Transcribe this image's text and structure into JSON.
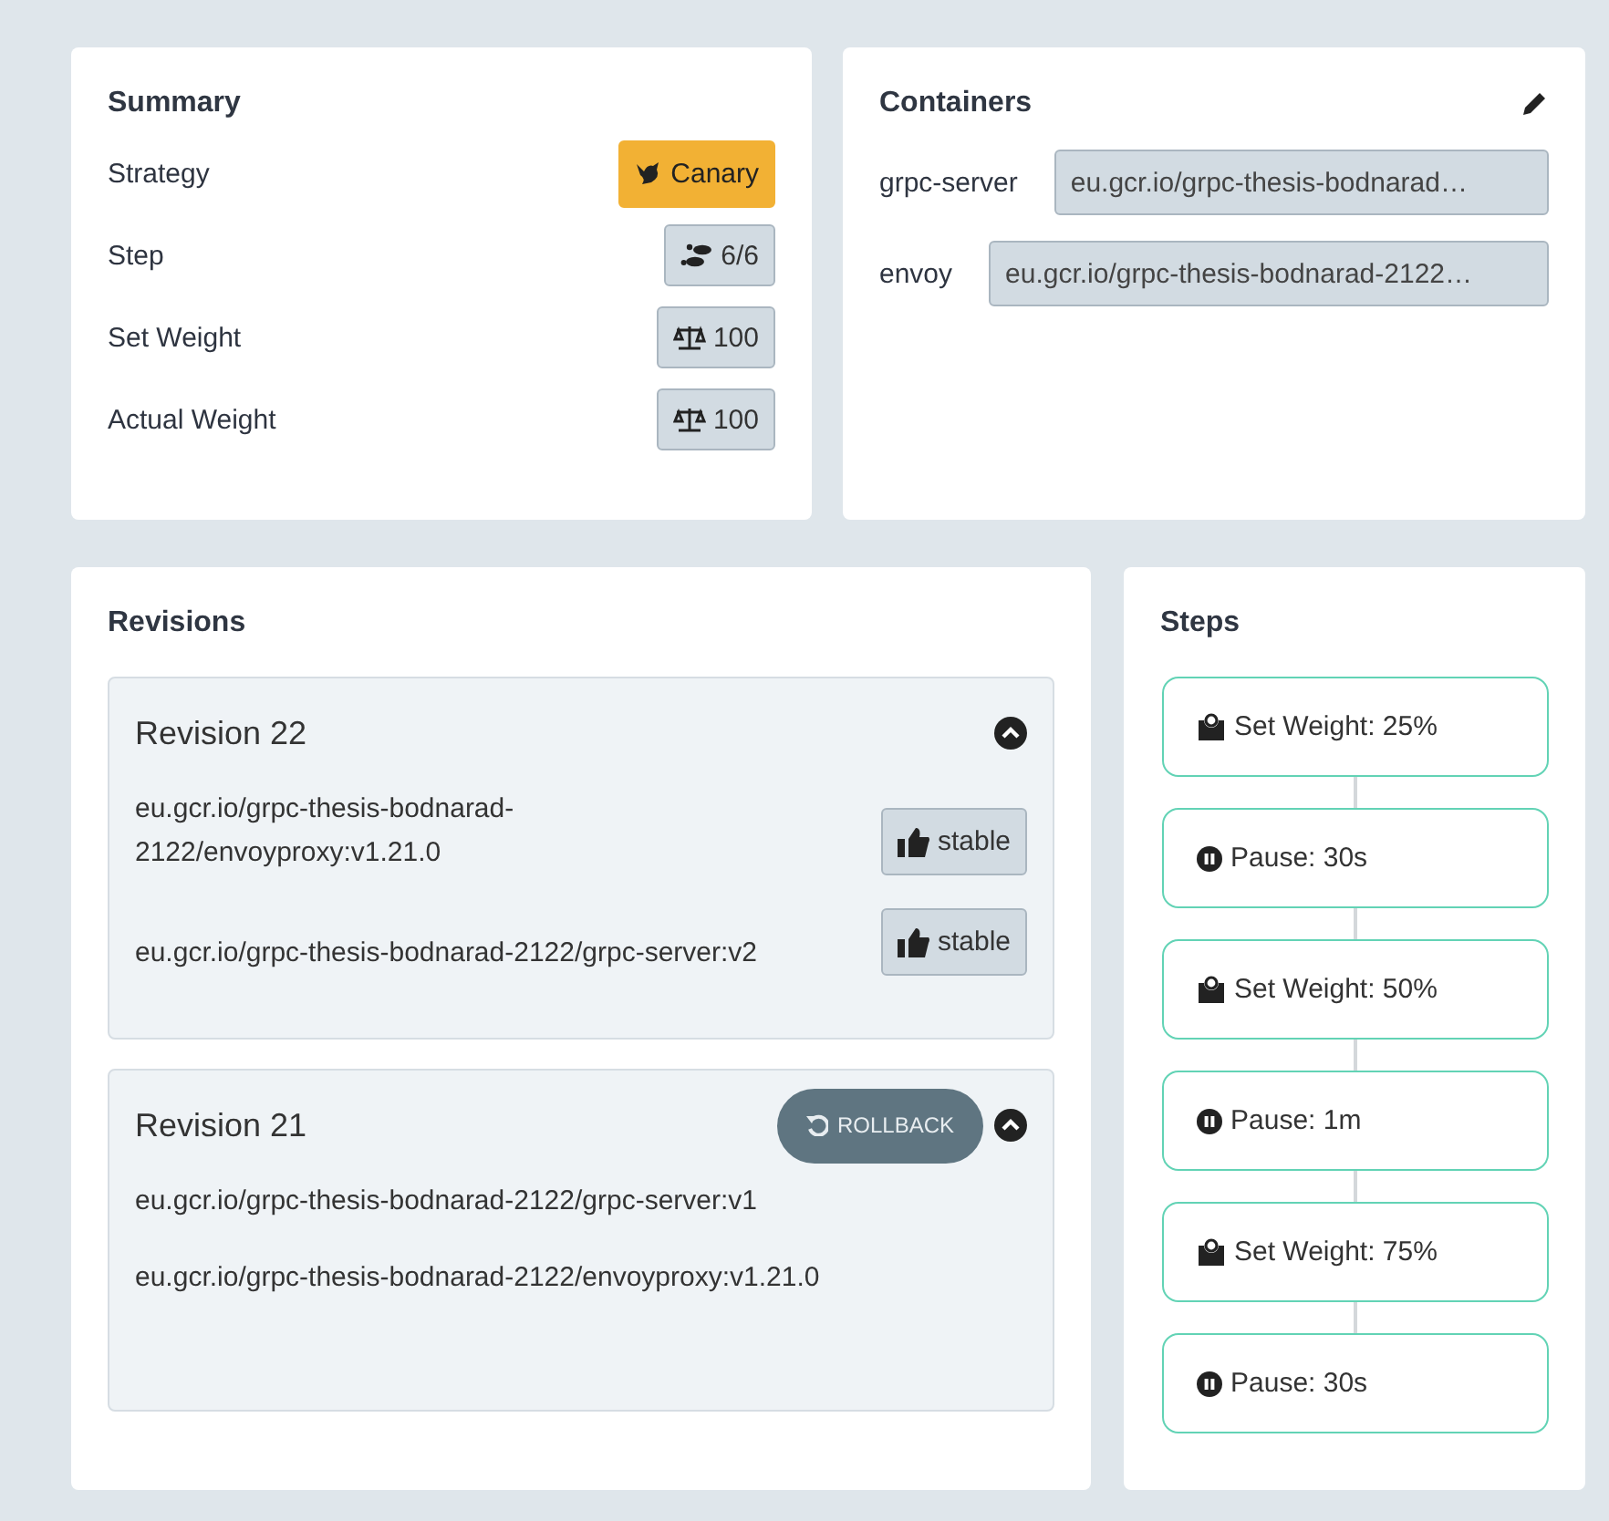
{
  "summary": {
    "title": "Summary",
    "rows": [
      {
        "label": "Strategy",
        "kind": "canary",
        "value": "Canary"
      },
      {
        "label": "Step",
        "kind": "steps",
        "value": "6/6"
      },
      {
        "label": "Set Weight",
        "kind": "set-weight",
        "value": "100"
      },
      {
        "label": "Actual Weight",
        "kind": "actual-weight",
        "value": "100"
      }
    ]
  },
  "containers": {
    "title": "Containers",
    "items": [
      {
        "name": "grpc-server",
        "image": "eu.gcr.io/grpc-thesis-bodnarad…"
      },
      {
        "name": "envoy",
        "image": "eu.gcr.io/grpc-thesis-bodnarad-2122…"
      }
    ]
  },
  "revisions": {
    "title": "Revisions",
    "items": [
      {
        "title": "Revision 22",
        "expanded": true,
        "images": [
          {
            "name": "eu.gcr.io/grpc-thesis-bodnarad-2122/envoyproxy:v1.21.0",
            "badge": "stable"
          },
          {
            "name": "eu.gcr.io/grpc-thesis-bodnarad-2122/grpc-server:v2",
            "badge": "stable"
          }
        ]
      },
      {
        "title": "Revision 21",
        "expanded": true,
        "action": "ROLLBACK",
        "images": [
          {
            "name": "eu.gcr.io/grpc-thesis-bodnarad-2122/grpc-server:v1"
          },
          {
            "name": "eu.gcr.io/grpc-thesis-bodnarad-2122/envoyproxy:v1.21.0"
          }
        ]
      }
    ]
  },
  "steps": {
    "title": "Steps",
    "items": [
      {
        "kind": "weight",
        "label": "Set Weight: 25%"
      },
      {
        "kind": "pause",
        "label": "Pause: 30s"
      },
      {
        "kind": "weight",
        "label": "Set Weight: 50%"
      },
      {
        "kind": "pause",
        "label": "Pause: 1m"
      },
      {
        "kind": "weight",
        "label": "Set Weight: 75%"
      },
      {
        "kind": "pause",
        "label": "Pause: 30s"
      }
    ]
  }
}
